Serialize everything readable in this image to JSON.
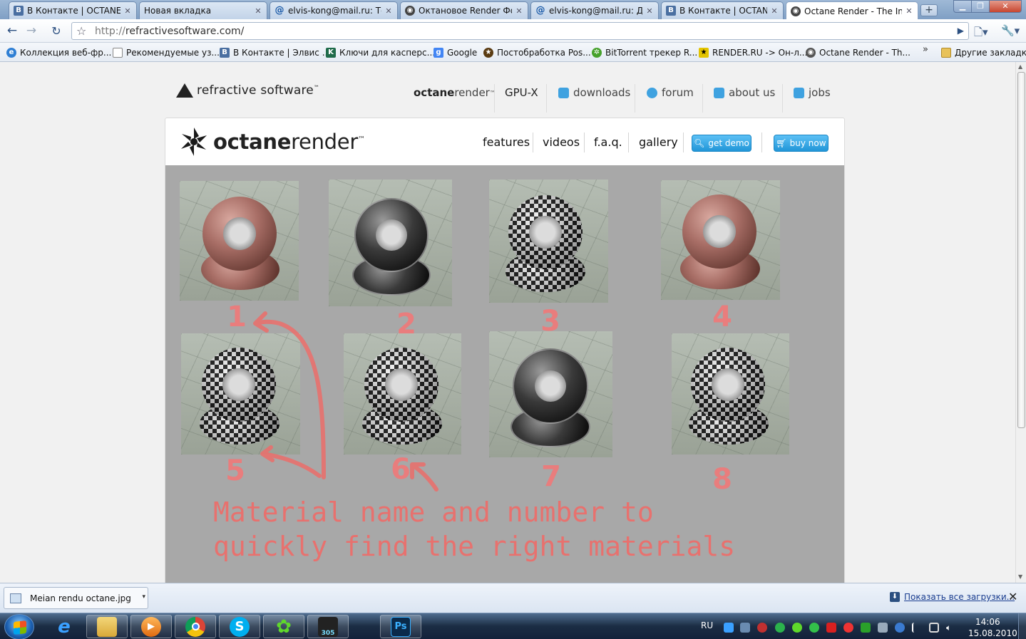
{
  "tabs": [
    {
      "label": "В Контакте | OCTANE ...",
      "icon": "vk-icon"
    },
    {
      "label": "Новая вкладка",
      "icon": ""
    },
    {
      "label": "elvis-kong@mail.ru: То...",
      "icon": "mail-at-icon"
    },
    {
      "label": "Октановое Render Фо...",
      "icon": "camera-icon"
    },
    {
      "label": "elvis-kong@mail.ru: Да...",
      "icon": "mail-at-icon"
    },
    {
      "label": "В Контакте | OCTANE ...",
      "icon": "vk-icon"
    },
    {
      "label": "Octane Render - The In...",
      "icon": "octane-icon",
      "active": true
    }
  ],
  "toolbar": {
    "url_scheme": "http://",
    "url_host": "refractivesoftware.com/"
  },
  "bookmarks": [
    {
      "label": "Коллекция веб-фр...",
      "icon": "ie-icon",
      "color": "#2f7fd4"
    },
    {
      "label": "Рекомендуемые уз...",
      "icon": "page-icon",
      "color": "#ffffff"
    },
    {
      "label": "В Контакте | Элвис ...",
      "icon": "vk-icon",
      "color": "#4a6fa1"
    },
    {
      "label": "Ключи для касперс...",
      "icon": "kaspersky-icon",
      "color": "#1f6b4a"
    },
    {
      "label": "Google",
      "icon": "google-icon",
      "color": "#4285f4"
    },
    {
      "label": "Постобработка Pos...",
      "icon": "star-badge-icon",
      "color": "#5a3b12"
    },
    {
      "label": "BitTorrent трекер R...",
      "icon": "torrent-icon",
      "color": "#46a12b"
    },
    {
      "label": "RENDER.RU -> Он-л...",
      "icon": "render-ru-icon",
      "color": "#e3c400"
    },
    {
      "label": "Octane Render - Th...",
      "icon": "camera-icon",
      "color": "#555555"
    }
  ],
  "bookmarks_other": "Другие закладки",
  "site": {
    "brand": "refractive software",
    "brand_tm": "™",
    "nav": [
      {
        "label_bold": "octane",
        "label": "render",
        "tm": "™"
      },
      {
        "label": "GPU-X"
      },
      {
        "label": "downloads"
      },
      {
        "label": "forum"
      },
      {
        "label": "about us"
      },
      {
        "label": "jobs"
      }
    ]
  },
  "panel": {
    "logo_bold": "octane",
    "logo_rest": "render",
    "logo_tm": "™",
    "nav": [
      "features",
      "videos",
      "f.a.q.",
      "gallery"
    ],
    "get_demo": "get demo",
    "buy_now": "buy now"
  },
  "gallery": {
    "tiles": [
      {
        "number": "1",
        "material": "granite"
      },
      {
        "number": "2",
        "material": "glass"
      },
      {
        "number": "3",
        "material": "checker"
      },
      {
        "number": "4",
        "material": "granite"
      },
      {
        "number": "5",
        "material": "checker"
      },
      {
        "number": "6",
        "material": "checker"
      },
      {
        "number": "7",
        "material": "glass"
      },
      {
        "number": "8",
        "material": "checker"
      }
    ],
    "caption_line1": "Material name and number to",
    "caption_line2": "quickly find the right materials",
    "annotation_color": "#e8716e"
  },
  "download_shelf": {
    "file_name": "Meian rendu octane.jpg",
    "show_all": "Показать все загрузки..."
  },
  "taskbar": {
    "apps": [
      {
        "name": "ie",
        "label": ""
      },
      {
        "name": "explorer",
        "label": ""
      },
      {
        "name": "media-player",
        "label": ""
      },
      {
        "name": "chrome",
        "label": ""
      },
      {
        "name": "skype",
        "label": ""
      },
      {
        "name": "icq",
        "label": ""
      },
      {
        "name": "nero",
        "label": "305"
      },
      {
        "name": "photoshop",
        "label": "Ps"
      }
    ],
    "lang": "RU",
    "time": "14:06",
    "date": "15.08.2010"
  }
}
